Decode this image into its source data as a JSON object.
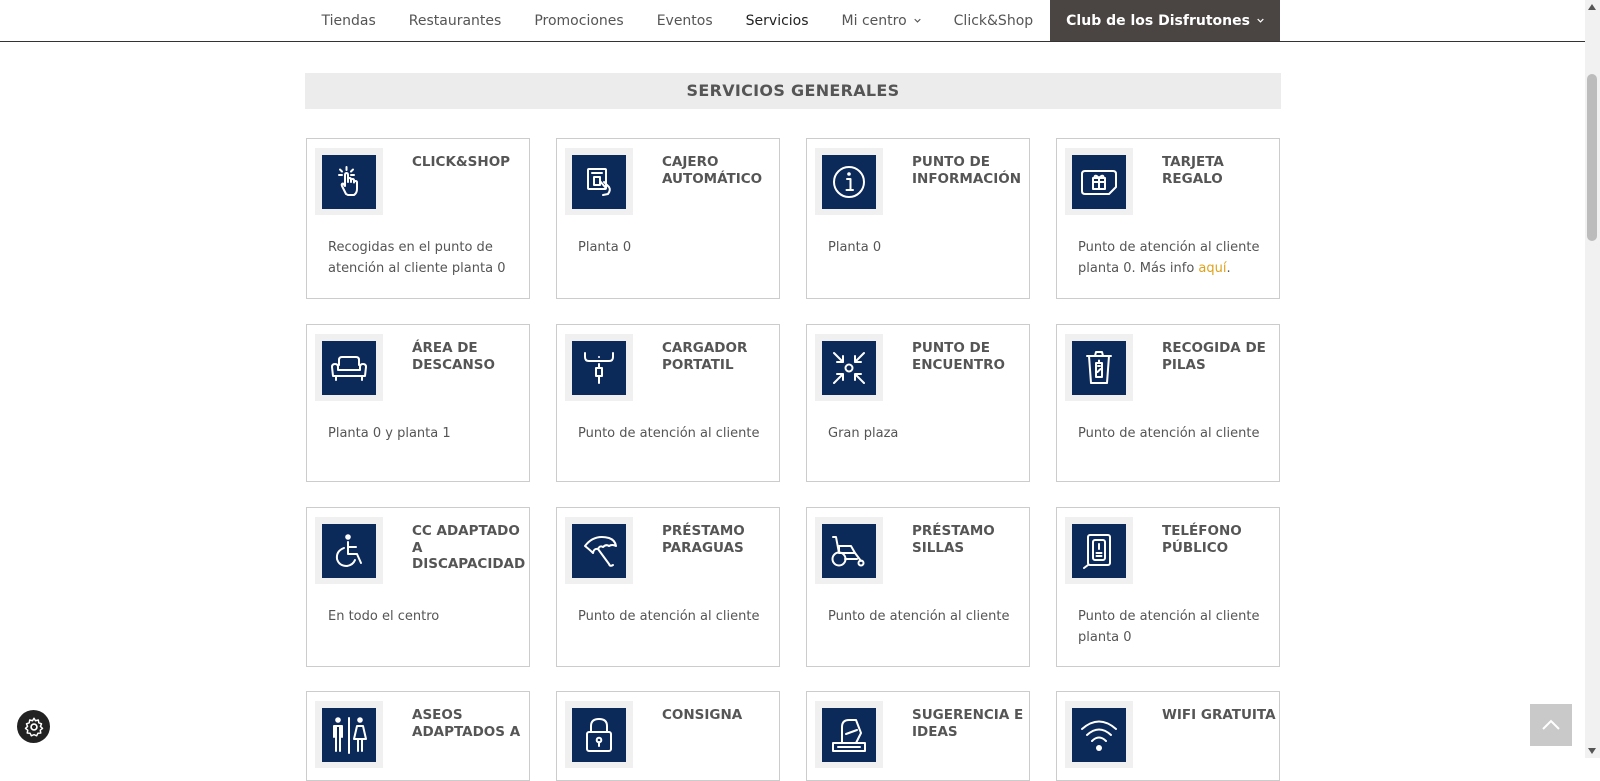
{
  "nav": {
    "items": [
      {
        "label": "Tiendas"
      },
      {
        "label": "Restaurantes"
      },
      {
        "label": "Promociones"
      },
      {
        "label": "Eventos"
      },
      {
        "label": "Servicios"
      },
      {
        "label": "Mi centro"
      },
      {
        "label": "Click&Shop"
      },
      {
        "label": "Club de los Disfrutones"
      }
    ]
  },
  "section": {
    "title": "SERVICIOS GENERALES"
  },
  "cards": [
    {
      "title": "CLICK&SHOP",
      "desc": "Recogidas en el punto de atención al cliente planta 0",
      "icon": "touch-hand-icon"
    },
    {
      "title": "CAJERO AUTOMÁTICO",
      "desc": "Planta 0",
      "icon": "atm-icon"
    },
    {
      "title": "PUNTO DE INFORMACIÓN",
      "desc": "Planta 0",
      "icon": "info-icon"
    },
    {
      "title": "TARJETA REGALO",
      "desc": "Punto de atención al cliente planta 0. Más info ",
      "link": "aquí",
      "desc_end": ".",
      "icon": "gift-card-icon"
    },
    {
      "title": "ÁREA DE DESCANSO",
      "desc": "Planta 0 y planta 1",
      "icon": "sofa-icon"
    },
    {
      "title": "CARGADOR PORTATIL",
      "desc": "Punto de atención al cliente",
      "icon": "charger-icon"
    },
    {
      "title": "PUNTO DE ENCUENTRO",
      "desc": "Gran plaza",
      "icon": "meeting-point-icon"
    },
    {
      "title": "RECOGIDA DE PILAS",
      "desc": "Punto de atención al cliente",
      "icon": "battery-recycle-icon"
    },
    {
      "title": "CC ADAPTADO A DISCAPACIDAD",
      "desc": "En todo el centro",
      "icon": "wheelchair-icon"
    },
    {
      "title": "PRÉSTAMO PARAGUAS",
      "desc": "Punto de atención al cliente",
      "icon": "umbrella-icon"
    },
    {
      "title": "PRÉSTAMO SILLAS",
      "desc": "Punto de atención al cliente",
      "icon": "stroller-icon"
    },
    {
      "title": "TELÉFONO PÚBLICO",
      "desc": "Punto de atención al cliente planta 0",
      "icon": "phone-icon"
    },
    {
      "title": "ASEOS ADAPTADOS A",
      "desc": "",
      "icon": "restroom-icon"
    },
    {
      "title": "CONSIGNA",
      "desc": "",
      "icon": "lock-icon"
    },
    {
      "title": "SUGERENCIA E IDEAS",
      "desc": "",
      "icon": "suggestion-box-icon"
    },
    {
      "title": "WIFI GRATUITA",
      "desc": "",
      "icon": "wifi-icon"
    }
  ],
  "colors": {
    "icon_bg": "#0b2a5a",
    "active_nav": "#4a4442",
    "link": "#e0a21b"
  }
}
